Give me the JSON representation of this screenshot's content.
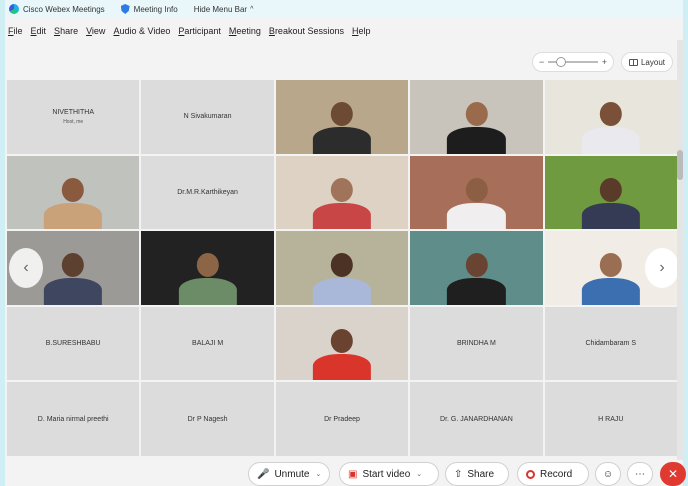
{
  "titlebar": {
    "app_name": "Cisco Webex Meetings",
    "meeting_info": "Meeting Info",
    "hide_menu": "Hide Menu Bar"
  },
  "menu": [
    "File",
    "Edit",
    "Share",
    "View",
    "Audio & Video",
    "Participant",
    "Meeting",
    "Breakout Sessions",
    "Help"
  ],
  "view_controls": {
    "zoom_out": "−",
    "zoom_in": "+",
    "layout_label": "Layout"
  },
  "tiles": [
    {
      "type": "name",
      "name": "NIVETHITHA",
      "sub": "Host, me"
    },
    {
      "type": "name",
      "name": "N Sivakumaran"
    },
    {
      "type": "video",
      "room": "#b9a78c",
      "skin": "#6d4a34",
      "shirt": "#2c2c2c"
    },
    {
      "type": "video",
      "room": "#c9c4bb",
      "skin": "#9a6a4c",
      "shirt": "#1d1d1d"
    },
    {
      "type": "video",
      "room": "#e8e5dc",
      "skin": "#7a5038",
      "shirt": "#e9e9ee"
    },
    {
      "type": "video",
      "room": "#bfc2bd",
      "skin": "#8a5a3e",
      "shirt": "#c9a27a"
    },
    {
      "type": "name",
      "name": "Dr.M.R.Karthikeyan"
    },
    {
      "type": "video",
      "room": "#ded2c4",
      "skin": "#a0745a",
      "shirt": "#c94646"
    },
    {
      "type": "video",
      "room": "#a76e5a",
      "skin": "#8c5e44",
      "shirt": "#f0eeee"
    },
    {
      "type": "video",
      "room": "#6f9a3f",
      "skin": "#5a3a28",
      "shirt": "#353a55"
    },
    {
      "type": "video",
      "room": "#9c9a96",
      "skin": "#5e4030",
      "shirt": "#3f4660"
    },
    {
      "type": "video",
      "room": "#222222",
      "skin": "#8c6446",
      "shirt": "#6b8c66"
    },
    {
      "type": "video",
      "room": "#b7b39a",
      "skin": "#4c3224",
      "shirt": "#a9b8d8"
    },
    {
      "type": "video",
      "room": "#5f8e8a",
      "skin": "#6a4432",
      "shirt": "#1f1f1f"
    },
    {
      "type": "video",
      "room": "#f1ede6",
      "skin": "#9a6e52",
      "shirt": "#3b6fb0"
    },
    {
      "type": "name",
      "name": "B.SURESHBABU"
    },
    {
      "type": "name",
      "name": "BALAJI M"
    },
    {
      "type": "video",
      "room": "#d9d3cb",
      "skin": "#6a4230",
      "shirt": "#d9352a"
    },
    {
      "type": "name",
      "name": "BRINDHA M"
    },
    {
      "type": "name",
      "name": "Chidambaram S"
    },
    {
      "type": "name",
      "name": "D. Maria nirmal preethi"
    },
    {
      "type": "name",
      "name": "Dr P Nagesh"
    },
    {
      "type": "name",
      "name": "Dr Pradeep"
    },
    {
      "type": "name",
      "name": "Dr. G. JANARDHANAN"
    },
    {
      "type": "name",
      "name": "H RAJU"
    }
  ],
  "toolbar": {
    "unmute": "Unmute",
    "start_video": "Start video",
    "share": "Share",
    "record": "Record"
  },
  "icons": {
    "prev": "‹",
    "next": "›",
    "leave": "✕"
  },
  "colors": {
    "leave": "#e0392f",
    "mic_muted": "#d9342b"
  }
}
